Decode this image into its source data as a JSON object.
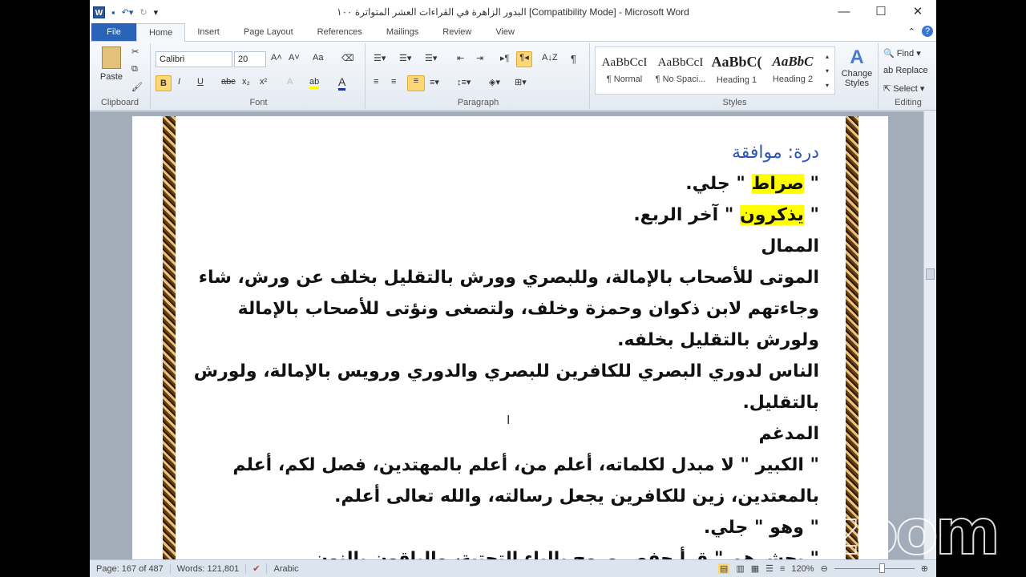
{
  "window": {
    "title": "البدور الزاهرة في القراءات العشر المتواترة ١٠٠ [Compatibility Mode] - Microsoft Word",
    "minimize": "—",
    "maximize": "☐",
    "close": "✕"
  },
  "tabs": [
    "File",
    "Home",
    "Insert",
    "Page Layout",
    "References",
    "Mailings",
    "Review",
    "View"
  ],
  "ribbon": {
    "clipboard": {
      "label": "Clipboard",
      "paste": "Paste"
    },
    "font": {
      "label": "Font",
      "name": "Calibri",
      "size": "20",
      "bold": "B",
      "italic": "I",
      "underline": "U",
      "strike": "abc",
      "sub": "x₂",
      "sup": "x²",
      "grow": "A˄",
      "shrink": "A˅",
      "case": "Aa",
      "color": "A",
      "highlight": "ab"
    },
    "paragraph": {
      "label": "Paragraph",
      "pilcrow": "¶",
      "sort": "A↓Z"
    },
    "styles": {
      "label": "Styles",
      "items": [
        {
          "preview": "AaBbCcI",
          "name": "¶ Normal"
        },
        {
          "preview": "AaBbCcI",
          "name": "¶ No Spaci..."
        },
        {
          "preview": "AaBbC(",
          "name": "Heading 1"
        },
        {
          "preview": "AaBbC",
          "name": "Heading 2"
        }
      ],
      "change": "Change Styles"
    },
    "editing": {
      "label": "Editing",
      "find": "Find",
      "replace": "Replace",
      "select": "Select"
    }
  },
  "document": {
    "heading": "درة: موافقة",
    "lines": [
      {
        "pre": "\" ",
        "hl": "صراط",
        "post": " \" جلي."
      },
      {
        "pre": "\" ",
        "hl": "يذكرون",
        "post": " \" آخر الربع."
      }
    ],
    "body": [
      "الممال",
      "الموتى للأصحاب بالإمالة، وللبصري وورش بالتقليل بخلف عن ورش، شاء",
      "وجاءتهم لابن ذكوان وحمزة وخلف، ولتصغى ونؤتى للأصحاب بالإمالة",
      "ولورش بالتقليل بخلفه.",
      "الناس لدوري البصري للكافرين للبصري والدوري ورويس بالإمالة، ولورش",
      "بالتقليل.",
      "المدغم",
      "\" الكبير \" لا مبدل لكلماته، أعلم من، أعلم بالمهتدين، فصل لكم، أعلم",
      "بالمعتدين، زين للكافرين يجعل رسالته، والله تعالى أعلم.",
      "\" وهو \" جلي.",
      "\" يحشرهم \" قرأ حفص وروح بالياء التحتية، والباقون بالنون."
    ]
  },
  "status": {
    "page": "Page: 167 of 487",
    "words": "Words: 121,801",
    "language": "Arabic",
    "zoom": "120%"
  },
  "watermark": "zoom"
}
